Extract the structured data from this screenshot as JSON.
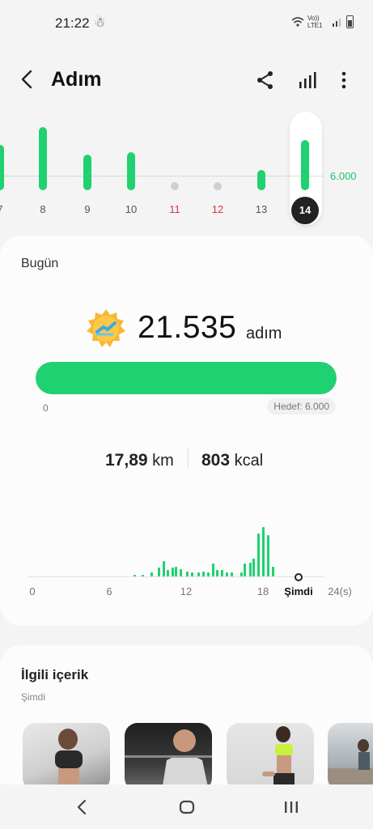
{
  "status": {
    "time": "21:22",
    "network": "Vo)) LTE1"
  },
  "header": {
    "title": "Adım"
  },
  "week": {
    "goal_label": "6.000",
    "days": [
      {
        "label": "7",
        "value": 11500,
        "weekend": false,
        "selected": false
      },
      {
        "label": "8",
        "value": 16000,
        "weekend": false,
        "selected": false
      },
      {
        "label": "9",
        "value": 9000,
        "weekend": false,
        "selected": false
      },
      {
        "label": "10",
        "value": 9600,
        "weekend": false,
        "selected": false
      },
      {
        "label": "11",
        "value": 0,
        "weekend": true,
        "selected": false
      },
      {
        "label": "12",
        "value": 0,
        "weekend": true,
        "selected": false
      },
      {
        "label": "13",
        "value": 5200,
        "weekend": false,
        "selected": false
      },
      {
        "label": "14",
        "value": 21535,
        "weekend": false,
        "selected": true
      }
    ]
  },
  "today": {
    "title": "Bugün",
    "steps": "21.535",
    "steps_unit": "adım",
    "progress_fraction": 1.0,
    "progress_min": "0",
    "goal": "Hedef: 6.000",
    "distance_value": "17,89",
    "distance_unit": "km",
    "calories_value": "803",
    "calories_unit": "kcal",
    "hourly": {
      "ticks": [
        "0",
        "6",
        "12",
        "18",
        "Şimdi",
        "24(s)"
      ],
      "bars": [
        {
          "h": 8.3,
          "v": 3
        },
        {
          "h": 9.0,
          "v": 3
        },
        {
          "h": 9.7,
          "v": 6
        },
        {
          "h": 10.3,
          "v": 14
        },
        {
          "h": 10.7,
          "v": 24
        },
        {
          "h": 11.0,
          "v": 10
        },
        {
          "h": 11.4,
          "v": 14
        },
        {
          "h": 11.7,
          "v": 16
        },
        {
          "h": 12.1,
          "v": 11
        },
        {
          "h": 12.6,
          "v": 8
        },
        {
          "h": 13.0,
          "v": 6
        },
        {
          "h": 13.5,
          "v": 6
        },
        {
          "h": 13.9,
          "v": 8
        },
        {
          "h": 14.3,
          "v": 6
        },
        {
          "h": 14.7,
          "v": 20
        },
        {
          "h": 15.0,
          "v": 10
        },
        {
          "h": 15.4,
          "v": 10
        },
        {
          "h": 15.8,
          "v": 6
        },
        {
          "h": 16.2,
          "v": 6
        },
        {
          "h": 17.0,
          "v": 6
        },
        {
          "h": 17.3,
          "v": 20
        },
        {
          "h": 17.7,
          "v": 22
        },
        {
          "h": 18.0,
          "v": 28
        },
        {
          "h": 18.4,
          "v": 68
        },
        {
          "h": 18.8,
          "v": 78
        },
        {
          "h": 19.2,
          "v": 66
        },
        {
          "h": 19.6,
          "v": 16
        }
      ]
    }
  },
  "related": {
    "title": "İlgili içerik",
    "subtitle": "Şimdi"
  },
  "colors": {
    "accent": "#1fd170",
    "weekend": "#d9363b",
    "dark": "#222222"
  }
}
